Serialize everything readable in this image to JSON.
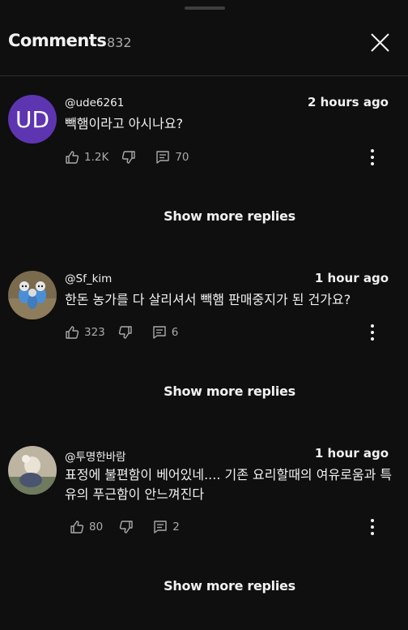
{
  "header": {
    "title": "Comments",
    "count": "832"
  },
  "comments": [
    {
      "avatar_text": "UD",
      "author": "@ude6261",
      "time": "2 hours ago",
      "text": "빽햄이라고 아시나요?",
      "likes": "1.2K",
      "replies": "70"
    },
    {
      "author": "@Sf_kim",
      "time": "1 hour ago",
      "text": "한돈 농가를 다 살리셔서 빽햄 판매중지가 된 건가요?",
      "likes": "323",
      "replies": "6"
    },
    {
      "author": "@투명한바람",
      "time": "1 hour ago",
      "text": "표정에 불편함이 베어있네.... 기존 요리할때의 여유로움과 특유의 푸근함이 안느껴진다",
      "likes": "80",
      "replies": "2"
    }
  ],
  "show_more_label": "Show more replies",
  "colors": {
    "background": "#0f0f0f",
    "text": "#f1f1f1",
    "secondary": "#aaaaaa",
    "avatar_ud": "#5e35b1"
  },
  "icons": [
    "close-icon",
    "like-icon",
    "dislike-icon",
    "reply-icon",
    "more-vert-icon"
  ]
}
